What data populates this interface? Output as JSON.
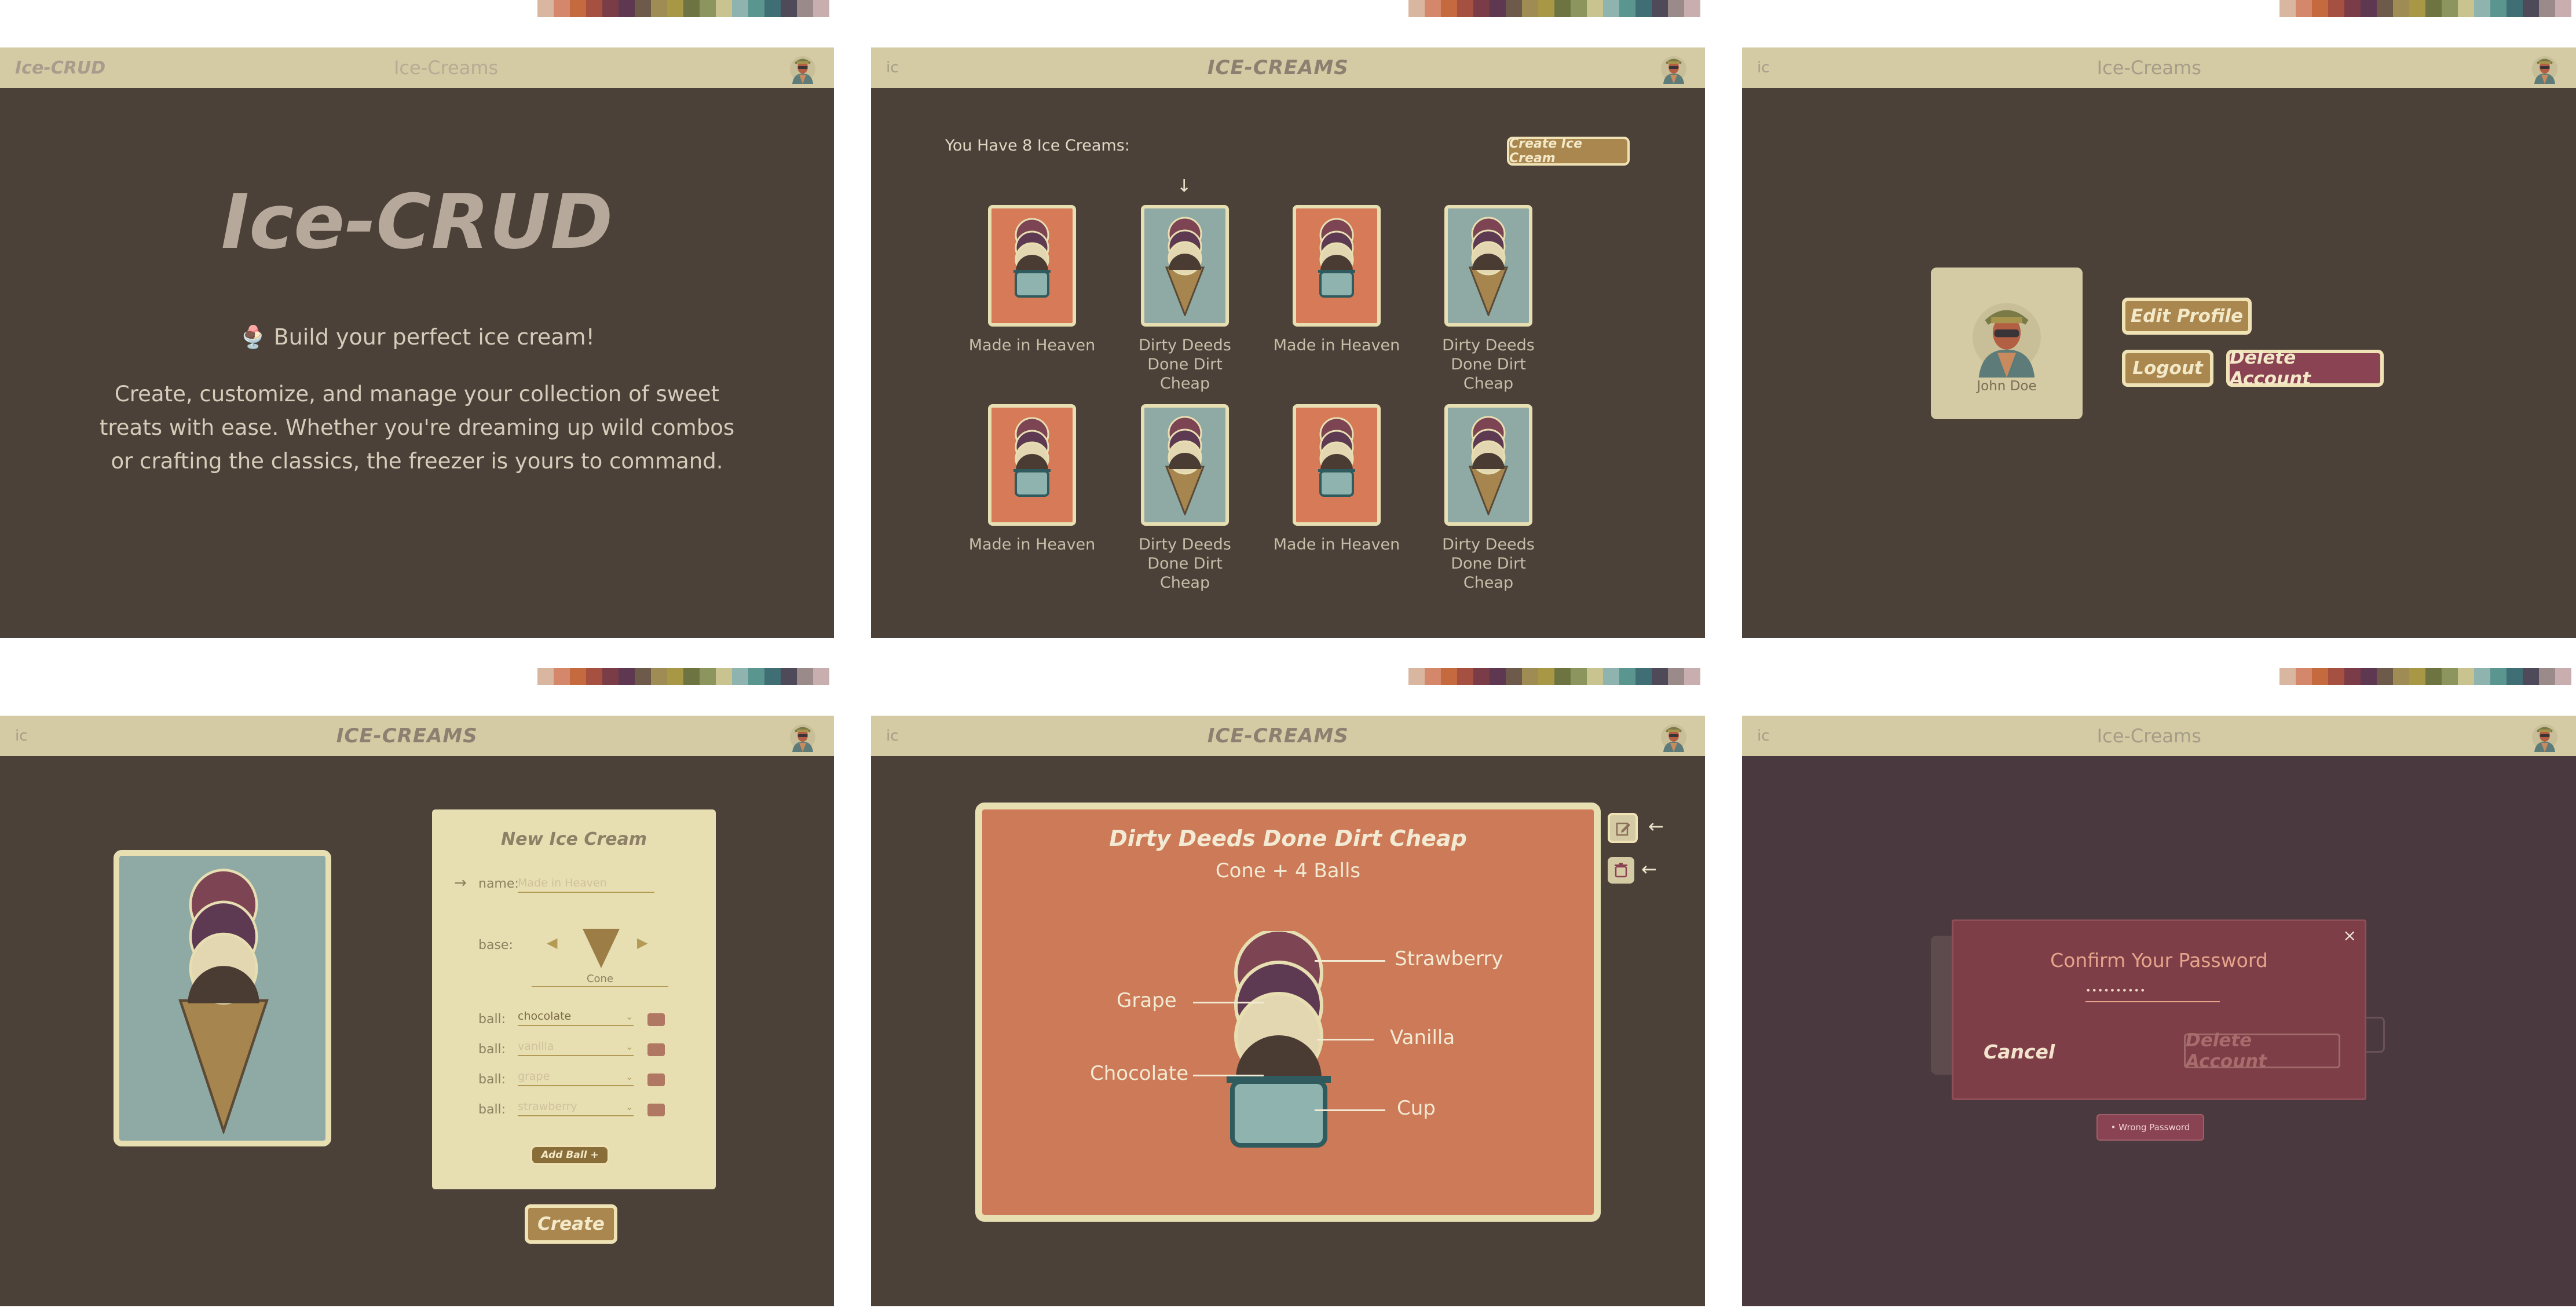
{
  "palette": [
    "#d9b69f",
    "#d4876a",
    "#c5693f",
    "#a55040",
    "#7a3c47",
    "#5e3850",
    "#6e5a4a",
    "#9f8c55",
    "#a89744",
    "#6d7442",
    "#8d955e",
    "#c9c48f",
    "#8fb3ae",
    "#5a9590",
    "#3f6f74",
    "#4f4a5a",
    "#9a8a8a",
    "#c8aeae"
  ],
  "colors": {
    "bg": "#4b4138",
    "topbar": "#d4cba4",
    "orange": "#d77a58",
    "teal": "#8fa9a5",
    "cream": "#e7dfb2",
    "plum": "#6a3d53",
    "wine": "#7d3e47"
  },
  "panel1": {
    "nav_brand": "Ice-CRUD",
    "nav_title": "Ice-Creams",
    "hero_title": "Ice-CRUD",
    "tagline_icon": "🍨",
    "tagline": "Build your perfect ice cream!",
    "description": "Create, customize, and manage your collection of sweet treats with ease. Whether you're dreaming up wild combos or crafting the classics, the freezer is yours to command."
  },
  "panel2": {
    "nav_brand": "ic",
    "nav_title": "ICE-CREAMS",
    "count_text": "You Have 8 Ice Creams:",
    "create_button": "Create Ice Cream",
    "arrow": "↓",
    "cards": [
      {
        "name": "Made in Heaven",
        "theme": "orange",
        "base": "cup"
      },
      {
        "name": "Dirty Deeds Done Dirt Cheap",
        "theme": "teal",
        "base": "cone"
      },
      {
        "name": "Made in Heaven",
        "theme": "orange",
        "base": "cup"
      },
      {
        "name": "Dirty Deeds Done Dirt Cheap",
        "theme": "teal",
        "base": "cone"
      },
      {
        "name": "Made in Heaven",
        "theme": "orange",
        "base": "cup"
      },
      {
        "name": "Dirty Deeds Done Dirt Cheap",
        "theme": "teal",
        "base": "cone"
      },
      {
        "name": "Made in Heaven",
        "theme": "orange",
        "base": "cup"
      },
      {
        "name": "Dirty Deeds Done Dirt Cheap",
        "theme": "teal",
        "base": "cone"
      }
    ]
  },
  "panel3": {
    "nav_brand": "ic",
    "nav_title": "Ice-Creams",
    "user_name": "John Doe",
    "edit_profile": "Edit Profile",
    "logout": "Logout",
    "delete_account": "Delete Account"
  },
  "panel4": {
    "nav_brand": "ic",
    "nav_title": "ICE-CREAMS",
    "form_title": "New Ice Cream",
    "arrow": "→",
    "name_label": "name:",
    "name_placeholder": "Made in Heaven",
    "base_label": "base:",
    "base_value": "Cone",
    "ball_label": "ball:",
    "balls": [
      "chocolate",
      "vanilla",
      "grape",
      "strawberry"
    ],
    "add_ball": "Add Ball +",
    "create": "Create"
  },
  "panel5": {
    "nav_brand": "ic",
    "nav_title": "ICE-CREAMS",
    "title": "Dirty Deeds Done Dirt Cheap",
    "subtitle": "Cone + 4 Balls",
    "labels": {
      "strawberry": "Strawberry",
      "grape": "Grape",
      "vanilla": "Vanilla",
      "chocolate": "Chocolate",
      "cup": "Cup"
    },
    "arrow1": "←",
    "arrow2": "←"
  },
  "panel6": {
    "nav_brand": "ic",
    "nav_title": "Ice-Creams",
    "modal_title": "Confirm Your Password",
    "password_mask": "••••••••••",
    "close": "×",
    "cancel": "Cancel",
    "delete_account": "Delete Account",
    "error": "• Wrong Password"
  }
}
